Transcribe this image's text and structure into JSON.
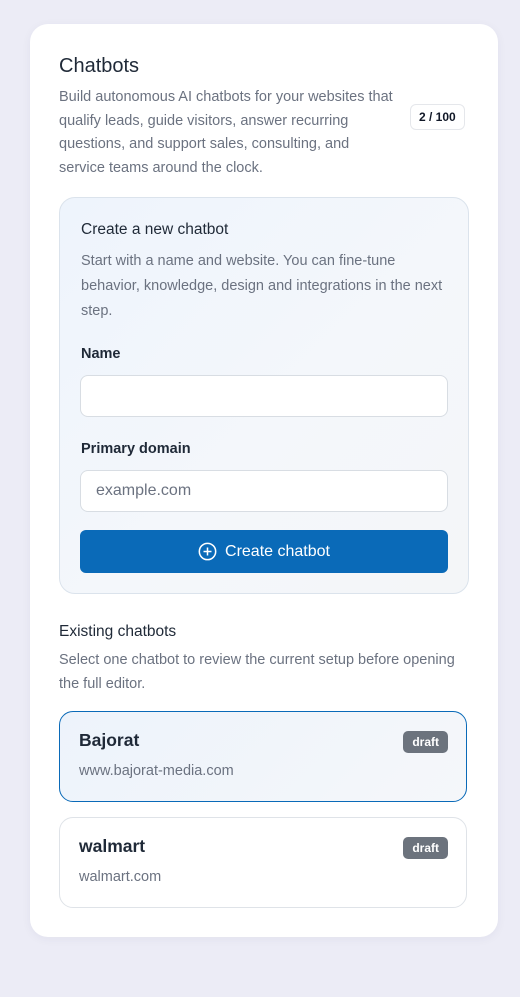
{
  "header": {
    "title": "Chatbots",
    "description": "Build autonomous AI chatbots for your websites that qualify leads, guide visitors, answer recurring questions, and support sales, consulting, and service teams around the clock.",
    "usage_badge": "2 / 100"
  },
  "create_form": {
    "title": "Create a new chatbot",
    "description": "Start with a name and website. You can fine-tune behavior, knowledge, design and integrations in the next step.",
    "name_label": "Name",
    "name_value": "",
    "domain_label": "Primary domain",
    "domain_placeholder": "example.com",
    "domain_value": "",
    "submit_label": "Create chatbot",
    "submit_icon": "plus-circle-icon"
  },
  "existing": {
    "title": "Existing chatbots",
    "description": "Select one chatbot to review the current setup before opening the full editor.",
    "bots": [
      {
        "name": "Bajorat",
        "domain": "www.bajorat-media.com",
        "status": "draft",
        "selected": true
      },
      {
        "name": "walmart",
        "domain": "walmart.com",
        "status": "draft",
        "selected": false
      }
    ]
  },
  "colors": {
    "background": "#ececf6",
    "card": "#ffffff",
    "accent": "#0a6ab8",
    "status_badge": "#6c737d",
    "text_primary": "#1f2937",
    "text_secondary": "#6b7280"
  }
}
